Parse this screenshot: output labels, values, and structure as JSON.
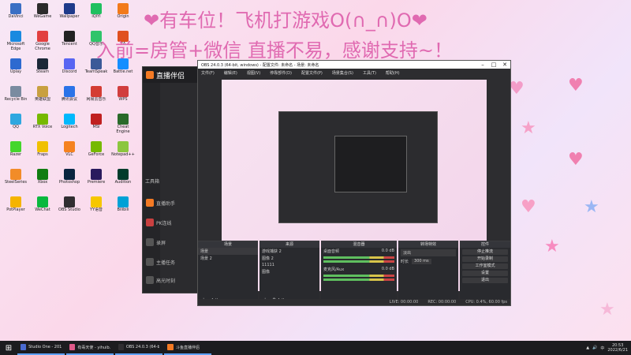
{
  "overlay": {
    "line1": "❤有车位！飞机打游戏O(∩_∩)O❤",
    "line2": "入前=房管+微信 直播不易，感谢支持~！"
  },
  "desktop_icons": [
    {
      "label": "DaVinci",
      "color": "#3a6fc4"
    },
    {
      "label": "WeGame",
      "color": "#2b2b2b"
    },
    {
      "label": "Wallpaper",
      "color": "#1e3a8a"
    },
    {
      "label": "iQIYI",
      "color": "#20c060"
    },
    {
      "label": "Origin",
      "color": "#f27a1a"
    },
    {
      "label": "Microsoft Edge",
      "color": "#1a8ae0"
    },
    {
      "label": "Google Chrome",
      "color": "#e24040"
    },
    {
      "label": "Tencent",
      "color": "#222"
    },
    {
      "label": "QQ音乐",
      "color": "#2fc46a"
    },
    {
      "label": "EA",
      "color": "#e05020"
    },
    {
      "label": "Uplay",
      "color": "#2d6ad0"
    },
    {
      "label": "Steam",
      "color": "#1b2838"
    },
    {
      "label": "Discord",
      "color": "#5865f2"
    },
    {
      "label": "TeamSpeak",
      "color": "#3b5998"
    },
    {
      "label": "Battle.net",
      "color": "#148eff"
    },
    {
      "label": "Recycle Bin",
      "color": "#7a8ba0"
    },
    {
      "label": "英雄联盟",
      "color": "#c8a040"
    },
    {
      "label": "腾讯会议",
      "color": "#2a73e8"
    },
    {
      "label": "网易云音乐",
      "color": "#d43c33"
    },
    {
      "label": "WPS",
      "color": "#d13e3e"
    },
    {
      "label": "QQ",
      "color": "#2ea7e0"
    },
    {
      "label": "RTX Voice",
      "color": "#76b900"
    },
    {
      "label": "Logitech",
      "color": "#00b8fc"
    },
    {
      "label": "MSI",
      "color": "#c02020"
    },
    {
      "label": "Cheat Engine",
      "color": "#2a6a2a"
    },
    {
      "label": "Razer",
      "color": "#44d62c"
    },
    {
      "label": "Fraps",
      "color": "#f0c000"
    },
    {
      "label": "VLC",
      "color": "#f58220"
    },
    {
      "label": "GeForce",
      "color": "#76b900"
    },
    {
      "label": "Notepad++",
      "color": "#8cc63f"
    },
    {
      "label": "SteelSeries",
      "color": "#f28c28"
    },
    {
      "label": "Xbox",
      "color": "#107c10"
    },
    {
      "label": "Photoshop",
      "color": "#0a2540"
    },
    {
      "label": "Premiere",
      "color": "#2a1a5e"
    },
    {
      "label": "Audition",
      "color": "#003c2c"
    },
    {
      "label": "PotPlayer",
      "color": "#f5b400"
    },
    {
      "label": "WeChat",
      "color": "#09b83e"
    },
    {
      "label": "OBS Studio",
      "color": "#302e31"
    },
    {
      "label": "YY语音",
      "color": "#f6c700"
    },
    {
      "label": "Bilibili",
      "color": "#00a1d6"
    }
  ],
  "live_assistant": {
    "title": "直播伴侣",
    "nav": [
      "工具箱",
      "直播助手",
      "PK连线",
      "录屏",
      "主播任务",
      "高光时刻"
    ]
  },
  "obs": {
    "title": "OBS 24.0.3 (64-bit, windows) - 配置文件: 未命名 - 场景: 未命名",
    "menu": [
      "文件(F)",
      "编辑(E)",
      "视图(V)",
      "停靠部件(D)",
      "配置文件(P)",
      "场景集合(S)",
      "工具(T)",
      "帮助(H)"
    ],
    "docks": {
      "scenes": {
        "title": "场景",
        "items": [
          "场景",
          "场景 2"
        ]
      },
      "sources": {
        "title": "来源",
        "items": [
          "游戏捕获 2",
          "图像 2",
          "11111",
          "图像"
        ]
      },
      "mixer": {
        "title": "混音器",
        "items": [
          {
            "name": "桌面音频",
            "level": "0.0 dB"
          },
          {
            "name": "麦克风/Aux",
            "level": "0.0 dB"
          }
        ]
      },
      "transitions": {
        "title": "转场特效",
        "type": "淡出",
        "duration_label": "时长",
        "duration": "300 ms"
      },
      "controls": {
        "title": "控件",
        "buttons": [
          "停止推流",
          "开始录制",
          "工作室模式",
          "设置",
          "退出"
        ]
      }
    },
    "status": {
      "live": "LIVE: 00:00:00",
      "rec": "REC: 00:00:00",
      "cpu": "CPU: 0.4%, 60.00 fps"
    }
  },
  "taskbar": {
    "items": [
      {
        "label": "Studio One - 201...",
        "color": "#4a6ad0"
      },
      {
        "label": "有毒天使 - yihuib...",
        "color": "#e05a8a"
      },
      {
        "label": "OBS 24.0.3 (64-bi...",
        "color": "#302e31"
      },
      {
        "label": "斗鱼直播伴侣",
        "color": "#f47a24"
      }
    ],
    "time": "20:53",
    "date": "2022/6/21",
    "ime": "中"
  }
}
